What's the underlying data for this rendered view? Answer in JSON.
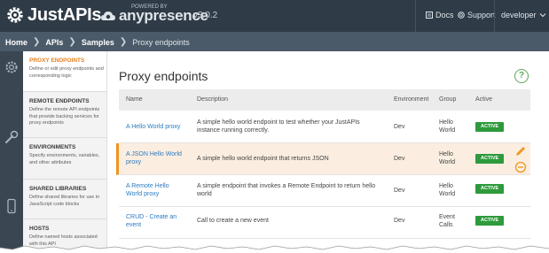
{
  "topbar": {
    "brand": "JustAPIs",
    "powered_by": "POWERED BY",
    "anypresence": "anypresence",
    "version": "v3.0.2",
    "docs": "Docs",
    "support": "Support",
    "user": "developer",
    "icons": [
      "justapis-gear-logo",
      "anypresence-cloud-logo",
      "docs-icon",
      "support-icon",
      "chevron-down-icon"
    ]
  },
  "breadcrumb": {
    "items": [
      "Home",
      "APIs",
      "Samples"
    ],
    "current": "Proxy endpoints"
  },
  "iconcol": {
    "icons": [
      "gear-icon",
      "wrench-icon",
      "mobile-icon"
    ]
  },
  "subnav": [
    {
      "title": "PROXY ENDPOINTS",
      "desc": "Define or edit proxy endpoints and corresponding logic",
      "active": true
    },
    {
      "title": "REMOTE ENDPOINTS",
      "desc": "Define the remote API endpoints that provide backing services for proxy endpoints",
      "active": false
    },
    {
      "title": "ENVIRONMENTS",
      "desc": "Specify environments, variables, and other attributes",
      "active": false
    },
    {
      "title": "SHARED LIBRARIES",
      "desc": "Define shared libraries for use in JavaScript code blocks",
      "active": false
    },
    {
      "title": "HOSTS",
      "desc": "Define named hosts associated with this API",
      "active": false
    }
  ],
  "main": {
    "title": "Proxy endpoints",
    "help": "?",
    "columns": [
      "Name",
      "Description",
      "Environment",
      "Group",
      "Active"
    ],
    "rows": [
      {
        "name": "A Hello World proxy",
        "description": "A simple hello world endpoint to test whether your JustAPIs instance running correctly.",
        "environment": "Dev",
        "group": "Hello World",
        "active": "ACTIVE"
      },
      {
        "name": "A JSON Hello World proxy",
        "description": "A simple hello world endpoint that returns JSON",
        "environment": "Dev",
        "group": "Hello World",
        "active": "ACTIVE"
      },
      {
        "name": "A Remote Hello World proxy",
        "description": "A simple endpoint that invokes a Remote Endpoint to return hello world",
        "environment": "Dev",
        "group": "Hello World",
        "active": "ACTIVE"
      },
      {
        "name": "CRUD - Create an event",
        "description": "Call to create a new event",
        "environment": "Dev",
        "group": "Event Calls",
        "active": "ACTIVE"
      }
    ]
  },
  "colors": {
    "topbar": "#2f3b47",
    "crumbbar": "#4b5a68",
    "accent_orange": "#f0941e",
    "active_green": "#2e9a3c",
    "link_blue": "#2c7bbf"
  }
}
